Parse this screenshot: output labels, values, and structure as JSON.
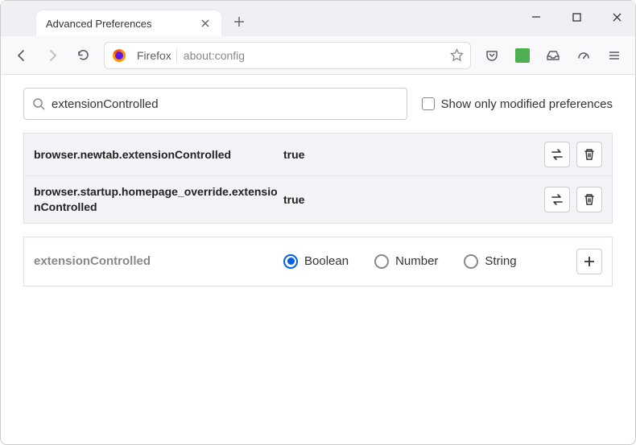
{
  "window": {
    "tab_title": "Advanced Preferences"
  },
  "urlbar": {
    "identity": "Firefox",
    "url": "about:config"
  },
  "search": {
    "value": "extensionControlled",
    "checkbox_label": "Show only modified preferences"
  },
  "prefs": [
    {
      "name": "browser.newtab.extensionControlled",
      "value": "true"
    },
    {
      "name": "browser.startup.homepage_override.extensionControlled",
      "value": "true"
    }
  ],
  "new_pref": {
    "name": "extensionControlled",
    "types": [
      "Boolean",
      "Number",
      "String"
    ],
    "selected": "Boolean"
  }
}
